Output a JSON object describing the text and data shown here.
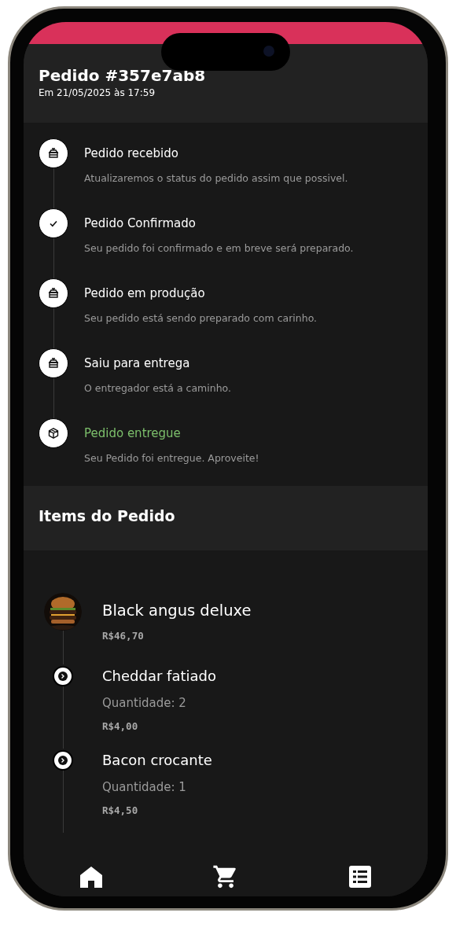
{
  "order": {
    "title": "Pedido #357e7ab8",
    "date": "Em 21/05/2025 às 17:59"
  },
  "steps": [
    {
      "kind": "kitchen",
      "title": "Pedido recebido",
      "description": "Atualizaremos o status do pedido assim que possivel.",
      "highlighted": false
    },
    {
      "kind": "check",
      "title": "Pedido Confirmado",
      "description": "Seu pedido foi confirmado e em breve será preparado.",
      "highlighted": false
    },
    {
      "kind": "kitchen",
      "title": "Pedido em produção",
      "description": "Seu pedido está sendo preparado com carinho.",
      "highlighted": false
    },
    {
      "kind": "kitchen",
      "title": "Saiu para entrega",
      "description": "O entregador está a caminho.",
      "highlighted": false
    },
    {
      "kind": "box",
      "title": "Pedido entregue",
      "description": "Seu Pedido foi entregue. Aproveite!",
      "highlighted": true
    }
  ],
  "items_section": {
    "title": "Items do Pedido"
  },
  "items": [
    {
      "kind": "product",
      "name": "Black angus deluxe",
      "price": "R$46,70"
    },
    {
      "kind": "addon",
      "name": "Cheddar fatiado",
      "quantity": "Quantidade: 2",
      "price": "R$4,00"
    },
    {
      "kind": "addon",
      "name": "Bacon crocante",
      "quantity": "Quantidade: 1",
      "price": "R$4,50"
    }
  ],
  "nav": [
    {
      "kind": "home"
    },
    {
      "kind": "cart"
    },
    {
      "kind": "list"
    }
  ]
}
